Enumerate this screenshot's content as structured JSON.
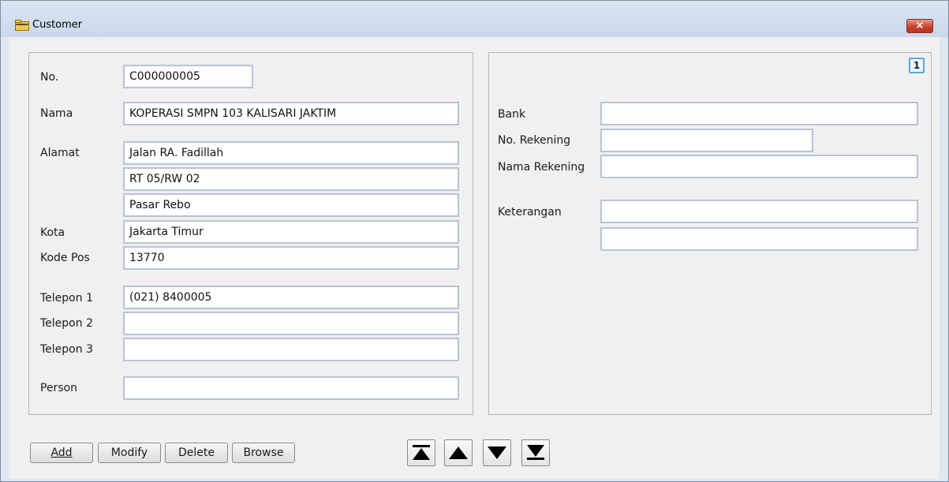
{
  "window": {
    "title": "Customer",
    "close_glyph": "×"
  },
  "left": {
    "no_label": "No.",
    "no_value": "C000000005",
    "nama_label": "Nama",
    "nama_value": "KOPERASI SMPN 103 KALISARI JAKTIM",
    "alamat_label": "Alamat",
    "alamat1": "Jalan RA. Fadillah",
    "alamat2": "RT 05/RW 02",
    "alamat3": "Pasar Rebo",
    "kota_label": "Kota",
    "kota_value": "Jakarta Timur",
    "kodepos_label": "Kode Pos",
    "kodepos_value": "13770",
    "telp1_label": "Telepon 1",
    "telp1_value": "(021) 8400005",
    "telp2_label": "Telepon 2",
    "telp2_value": "",
    "telp3_label": "Telepon 3",
    "telp3_value": "",
    "person_label": "Person",
    "person_value": ""
  },
  "right": {
    "page_indicator": "1",
    "bank_label": "Bank",
    "bank_value": "",
    "norek_label": "No. Rekening",
    "norek_value": "",
    "namarek_label": "Nama Rekening",
    "namarek_value": "",
    "ket_label": "Keterangan",
    "ket1_value": "",
    "ket2_value": ""
  },
  "buttons": {
    "add": "Add",
    "modify": "Modify",
    "delete": "Delete",
    "browse": "Browse"
  },
  "nav": {
    "first": "first-record-icon",
    "prev": "previous-record-icon",
    "next": "next-record-icon",
    "last": "last-record-icon"
  },
  "colors": {
    "close": "#c9452f",
    "field_border": "#b9c4d4",
    "accent": "#5aa9d8"
  }
}
